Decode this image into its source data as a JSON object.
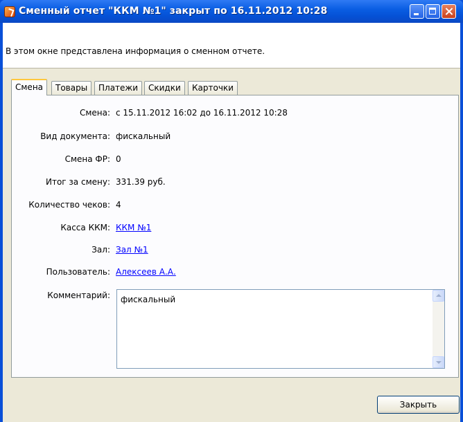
{
  "window": {
    "title": "Сменный отчет \"ККМ №1\" закрыт по 16.11.2012 10:28"
  },
  "info": {
    "text": "В этом окне представлена информация о сменном отчете."
  },
  "tabs": [
    {
      "label": "Смена",
      "active": true
    },
    {
      "label": "Товары",
      "active": false
    },
    {
      "label": "Платежи",
      "active": false
    },
    {
      "label": "Скидки",
      "active": false
    },
    {
      "label": "Карточки",
      "active": false
    }
  ],
  "fields": {
    "shift": {
      "label": "Смена:",
      "value": "с 15.11.2012 16:02 до 16.11.2012 10:28"
    },
    "doc_type": {
      "label": "Вид документа:",
      "value": "фискальный"
    },
    "fr_shift": {
      "label": "Смена ФР:",
      "value": "0"
    },
    "total": {
      "label": "Итог за смену:",
      "value": "331.39 руб."
    },
    "checks": {
      "label": "Количество чеков:",
      "value": "4"
    },
    "kkm": {
      "label": "Касса ККМ:",
      "value": "ККМ №1"
    },
    "hall": {
      "label": "Зал:",
      "value": "Зал №1"
    },
    "user": {
      "label": "Пользователь:",
      "value": "Алексеев А.А."
    },
    "comment": {
      "label": "Комментарий:",
      "value": "фискальный"
    }
  },
  "buttons": {
    "close": "Закрыть"
  },
  "icons": {
    "app": "app-icon",
    "minimize": "minimize-icon",
    "maximize": "maximize-icon",
    "close": "close-icon"
  }
}
